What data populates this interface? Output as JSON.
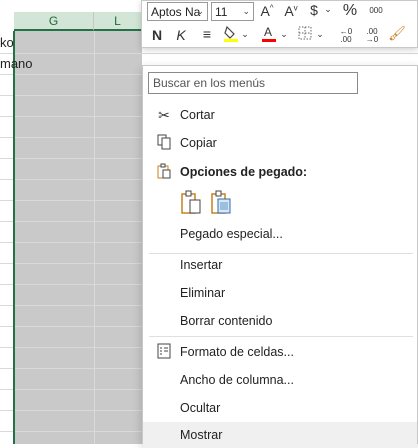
{
  "sheet": {
    "columns": [
      {
        "id": "g",
        "label": "G"
      },
      {
        "id": "l",
        "label": "L"
      }
    ],
    "cells": [
      "ko",
      "mano"
    ]
  },
  "mini_toolbar": {
    "font_name": "Aptos Na",
    "font_size": "11",
    "bold_label": "N",
    "italic_label": "K",
    "increase_font_icon": "A^",
    "decrease_font_icon": "Av",
    "currency_icon": "$",
    "percent_icon": "%",
    "thousands_icon": "000",
    "increase_decimals_icon": "←0 .00",
    "decrease_decimals_icon": ".00 →0",
    "fill_color": "#ffff00",
    "font_color": "#ff0000"
  },
  "menu": {
    "search_placeholder": "Buscar en los menús",
    "items": [
      {
        "label": "Cortar",
        "icon": "scissors-icon"
      },
      {
        "label": "Copiar",
        "icon": "copy-icon"
      },
      {
        "label": "Opciones de pegado:",
        "icon": "paste-icon"
      },
      {
        "label": "Pegado especial..."
      },
      {
        "label": "Insertar"
      },
      {
        "label": "Eliminar"
      },
      {
        "label": "Borrar contenido"
      },
      {
        "label": "Formato de celdas...",
        "icon": "format-cells-icon"
      },
      {
        "label": "Ancho de columna..."
      },
      {
        "label": "Ocultar"
      },
      {
        "label": "Mostrar"
      }
    ]
  }
}
